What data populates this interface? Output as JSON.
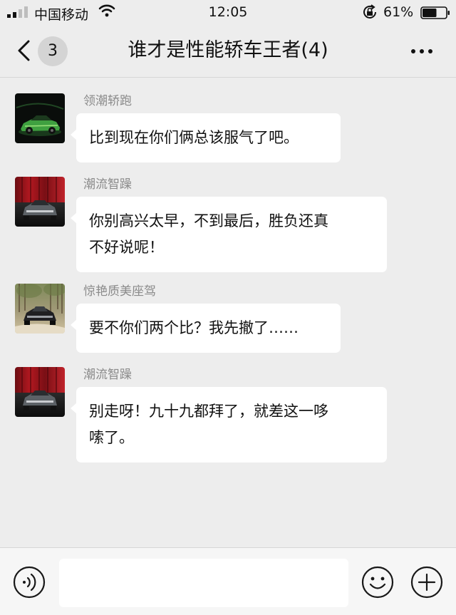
{
  "status_bar": {
    "carrier": "中国移动",
    "time": "12:05",
    "battery": "61%",
    "battery_level": 0.61,
    "icons": [
      "signal-icon",
      "wifi-icon",
      "rotation-lock-icon",
      "battery-icon"
    ]
  },
  "nav": {
    "title": "谁才是性能轿车王者(4)",
    "unread_count": "3",
    "icons": [
      "back-chevron-icon",
      "more-icon"
    ]
  },
  "messages": [
    {
      "sender": "领潮轿跑",
      "avatar": "green-sports-car",
      "lines": [
        "比到现在你们俩总该服气了吧。"
      ]
    },
    {
      "sender": "潮流智躁",
      "avatar": "grey-sedan-red-curtain",
      "lines": [
        "你别高兴太早，不到最后，胜负还真",
        "不好说呢！"
      ]
    },
    {
      "sender": "惊艳质美座驾",
      "avatar": "dark-sedan-forest",
      "lines": [
        "要不你们两个比？我先撤了……"
      ]
    },
    {
      "sender": "潮流智躁",
      "avatar": "grey-sedan-red-curtain",
      "lines": [
        "别走呀！九十九都拜了，就差这一哆",
        "嗦了。"
      ]
    }
  ],
  "input_bar": {
    "placeholder": "",
    "icons": [
      "voice-icon",
      "emoji-icon",
      "add-icon"
    ]
  },
  "colors": {
    "background": "#ededed",
    "bubble": "#ffffff",
    "sender_name": "#8a8a8a"
  }
}
